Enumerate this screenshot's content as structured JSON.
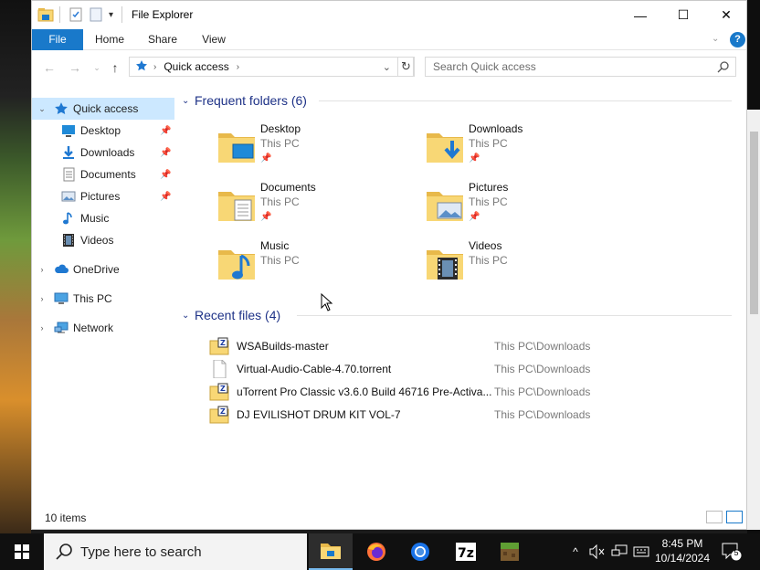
{
  "window": {
    "title": "File Explorer",
    "minimize_glyph": "—",
    "maximize_glyph": "☐",
    "close_glyph": "✕"
  },
  "ribbon": {
    "tabs": [
      "File",
      "Home",
      "Share",
      "View"
    ]
  },
  "address": {
    "location": "Quick access",
    "search_placeholder": "Search Quick access"
  },
  "sidebar": {
    "items": [
      {
        "label": "Quick access",
        "icon": "star-icon"
      },
      {
        "label": "Desktop",
        "icon": "desktop-icon"
      },
      {
        "label": "Downloads",
        "icon": "downloads-icon"
      },
      {
        "label": "Documents",
        "icon": "documents-icon"
      },
      {
        "label": "Pictures",
        "icon": "pictures-icon"
      },
      {
        "label": "Music",
        "icon": "music-icon"
      },
      {
        "label": "Videos",
        "icon": "videos-icon"
      },
      {
        "label": "OneDrive",
        "icon": "cloud-icon"
      },
      {
        "label": "This PC",
        "icon": "computer-icon"
      },
      {
        "label": "Network",
        "icon": "network-icon"
      }
    ]
  },
  "frequent": {
    "heading": "Frequent folders (6)",
    "folders": [
      {
        "name": "Desktop",
        "location": "This PC",
        "pinned": true
      },
      {
        "name": "Downloads",
        "location": "This PC",
        "pinned": true
      },
      {
        "name": "Documents",
        "location": "This PC",
        "pinned": true
      },
      {
        "name": "Pictures",
        "location": "This PC",
        "pinned": true
      },
      {
        "name": "Music",
        "location": "This PC",
        "pinned": false
      },
      {
        "name": "Videos",
        "location": "This PC",
        "pinned": false
      }
    ]
  },
  "recent": {
    "heading": "Recent files (4)",
    "files": [
      {
        "name": "WSABuilds-master",
        "path": "This PC\\Downloads",
        "icon": "zip-folder-icon"
      },
      {
        "name": "Virtual-Audio-Cable-4.70.torrent",
        "path": "This PC\\Downloads",
        "icon": "file-icon"
      },
      {
        "name": "uTorrent Pro Classic v3.6.0 Build 46716 Pre-Activa...",
        "path": "This PC\\Downloads",
        "icon": "zip-folder-icon"
      },
      {
        "name": "DJ EVILISHOT DRUM KIT VOL-7",
        "path": "This PC\\Downloads",
        "icon": "zip-folder-icon"
      }
    ]
  },
  "status": {
    "item_count": "10 items"
  },
  "taskbar": {
    "search_placeholder": "Type here to search",
    "time": "8:45 PM",
    "date": "10/14/2024",
    "notification_count": "5"
  },
  "colors": {
    "accent": "#1979ca",
    "selection": "#cce8ff",
    "group_heading": "#1e3287",
    "folder": "#f8d775"
  }
}
